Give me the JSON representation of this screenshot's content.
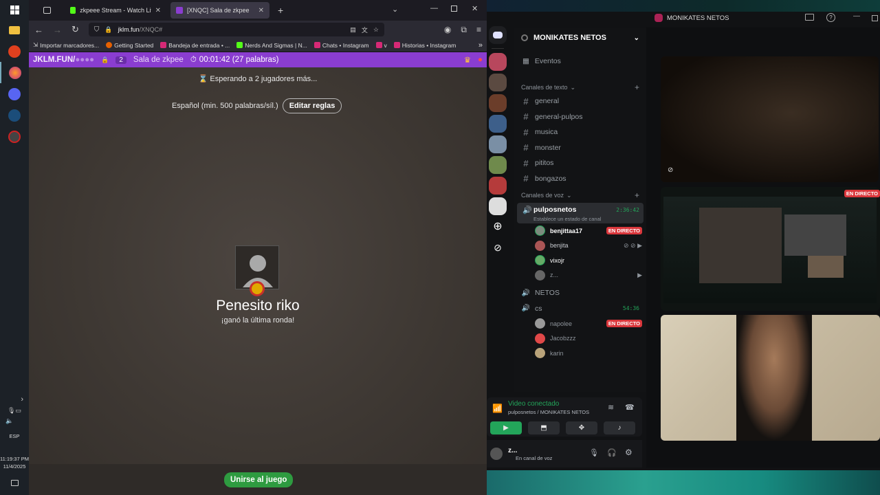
{
  "taskbar": {
    "clock_time": "11:19:37 PM",
    "clock_date": "11/4/2025",
    "language": "ESP"
  },
  "browser": {
    "tabs": [
      {
        "label": "zkpeee Stream - Watch Live on"
      },
      {
        "label": "[XNQC] Sala de zkpee"
      }
    ],
    "url_domain": "jklm.fun",
    "url_path": "/XNQC#",
    "bookmarks": [
      {
        "label": "Importar marcadores..."
      },
      {
        "label": "Getting Started"
      },
      {
        "label": "Bandeja de entrada • ..."
      },
      {
        "label": "Nerds And Sigmas | N..."
      },
      {
        "label": "Chats • Instagram"
      },
      {
        "label": "v"
      },
      {
        "label": "Historias • Instagram"
      }
    ]
  },
  "game": {
    "logo": "JKLM.FUN/",
    "player_count": "2",
    "room_name": "Sala de zkpee",
    "timer": "00:01:42 (27 palabras)",
    "waiting": "Esperando a 2 jugadores más...",
    "rules": "Español (min. 500 palabras/síl.)",
    "edit_rules": "Editar reglas",
    "winner_name": "Penesito riko",
    "winner_subtitle": "¡ganó la última ronda!",
    "join_button": "Unirse al juego"
  },
  "discord": {
    "window_title": "MONIKATES NETOS",
    "server_name": "MONIKATES NETOS",
    "events": "Eventos",
    "text_category": "Canales de texto",
    "text_channels": [
      "general",
      "general-pulpos",
      "musica",
      "monster",
      "pititos",
      "bongazos"
    ],
    "voice_category": "Canales de voz",
    "voice_channel": {
      "name": "pulposnetos",
      "time": "2:36:42",
      "status": "Establece un estado de canal"
    },
    "voice_users": [
      {
        "name": "benjittaa17",
        "badge": "EN DIRECTO"
      },
      {
        "name": "benjita"
      },
      {
        "name": "vixojr"
      },
      {
        "name": "z..."
      }
    ],
    "channel_netos": "NETOS",
    "channel_cs": {
      "name": "cs",
      "time": "54:36"
    },
    "cs_users": [
      {
        "name": "napolee",
        "badge": "EN DIRECTO"
      },
      {
        "name": "Jacobzzz"
      },
      {
        "name": "karin"
      }
    ],
    "rtc_status": "Video conectado",
    "rtc_location": "pulposnetos / MONIKATES NETOS",
    "user_name": "z...",
    "user_status": "En canal de voz",
    "stream_badge": "EN DIRECTO"
  },
  "colors": {
    "game_bar": "#8a3dd0",
    "join_green": "#2e9b40",
    "live_red": "#da373c",
    "discord_green": "#23a55a"
  }
}
